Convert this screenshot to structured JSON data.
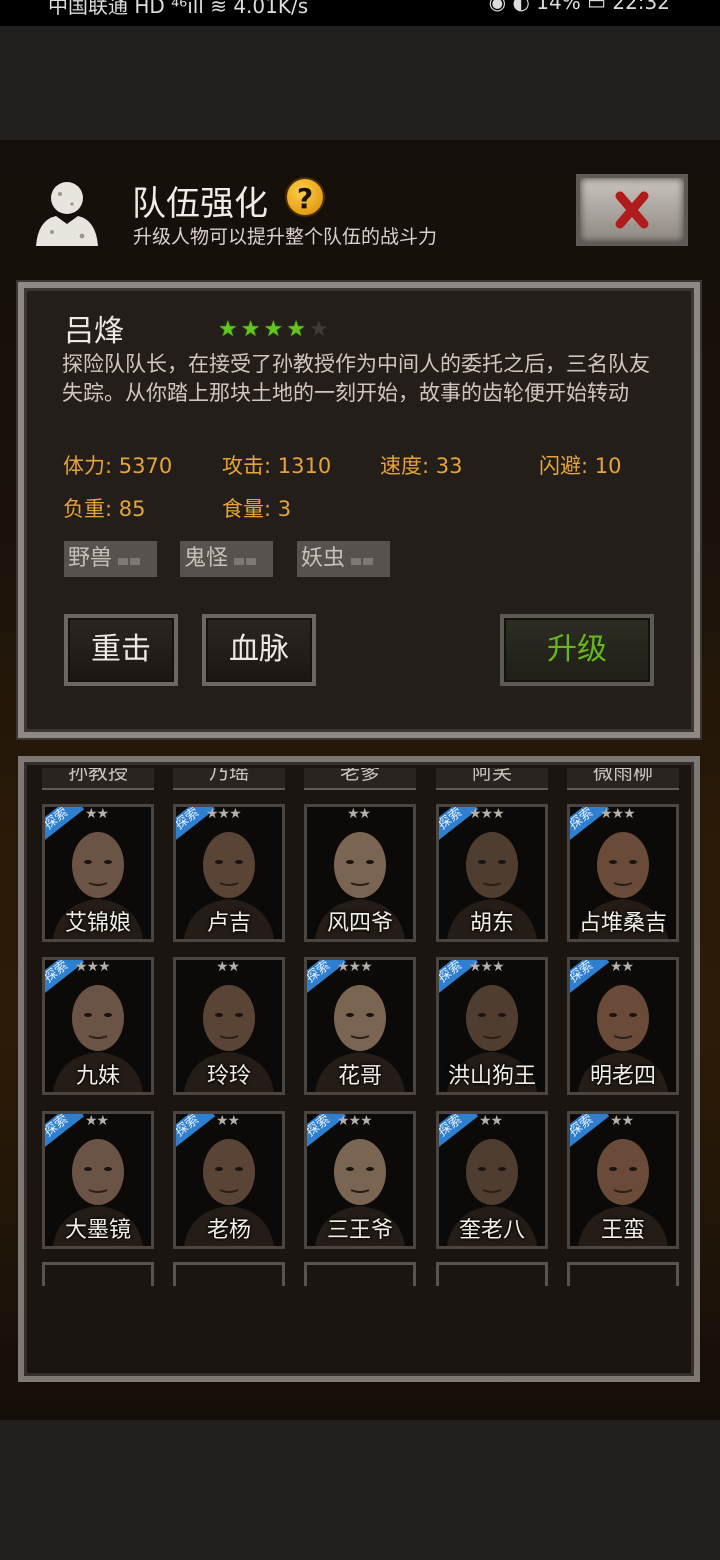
{
  "status_bar": {
    "left_text": "中国联通 HD ⁴⁶ıll ≋ 4.01K/s",
    "right_text": "◉ ◐ 14% ▭ 22:32"
  },
  "header": {
    "title": "队伍强化",
    "help_symbol": "?",
    "subtitle": "升级人物可以提升整个队伍的战斗力"
  },
  "hero": {
    "name": "吕烽",
    "stars_filled": 4,
    "stars_total": 5,
    "description": "探险队队长，在接受了孙教授作为中间人的委托之后，三名队友失踪。从你踏上那块土地的一刻开始，故事的齿轮便开始转动",
    "stats": {
      "hp": "体力: 5370",
      "attack": "攻击: 1310",
      "speed": "速度: 33",
      "dodge": "闪避: 10",
      "load": "负重: 85",
      "food": "食量: 3"
    },
    "tags": [
      "野兽",
      "鬼怪",
      "妖虫"
    ]
  },
  "buttons": {
    "heavy_strike": "重击",
    "bloodline": "血脉",
    "upgrade": "升级"
  },
  "accent_colors": {
    "stat_text": "#e5a43a",
    "upgrade_text": "#67b71c",
    "star_on": "#62c41d",
    "badge_blue": "#2f7fd0"
  },
  "partial_row_names": [
    "孙教授",
    "乃瑶",
    "老爹",
    "阿笑",
    "微雨柳"
  ],
  "characters": [
    {
      "name": "艾锦娘",
      "stars": "★★",
      "badge": "探索"
    },
    {
      "name": "卢吉",
      "stars": "★★★",
      "badge": "探索"
    },
    {
      "name": "风四爷",
      "stars": "★★",
      "badge": ""
    },
    {
      "name": "胡东",
      "stars": "★★★",
      "badge": "探索"
    },
    {
      "name": "占堆桑吉",
      "stars": "★★★",
      "badge": "探索"
    },
    {
      "name": "九妹",
      "stars": "★★★",
      "badge": "探索"
    },
    {
      "name": "玲玲",
      "stars": "★★",
      "badge": ""
    },
    {
      "name": "花哥",
      "stars": "★★★",
      "badge": "探索"
    },
    {
      "name": "洪山狗王",
      "stars": "★★★",
      "badge": "探索"
    },
    {
      "name": "明老四",
      "stars": "★★",
      "badge": "探索"
    },
    {
      "name": "大墨镜",
      "stars": "★★",
      "badge": "探索"
    },
    {
      "name": "老杨",
      "stars": "★★",
      "badge": "探索"
    },
    {
      "name": "三王爷",
      "stars": "★★★",
      "badge": "探索"
    },
    {
      "name": "奎老八",
      "stars": "★★",
      "badge": "探索"
    },
    {
      "name": "王蛮",
      "stars": "★★",
      "badge": "探索"
    }
  ]
}
